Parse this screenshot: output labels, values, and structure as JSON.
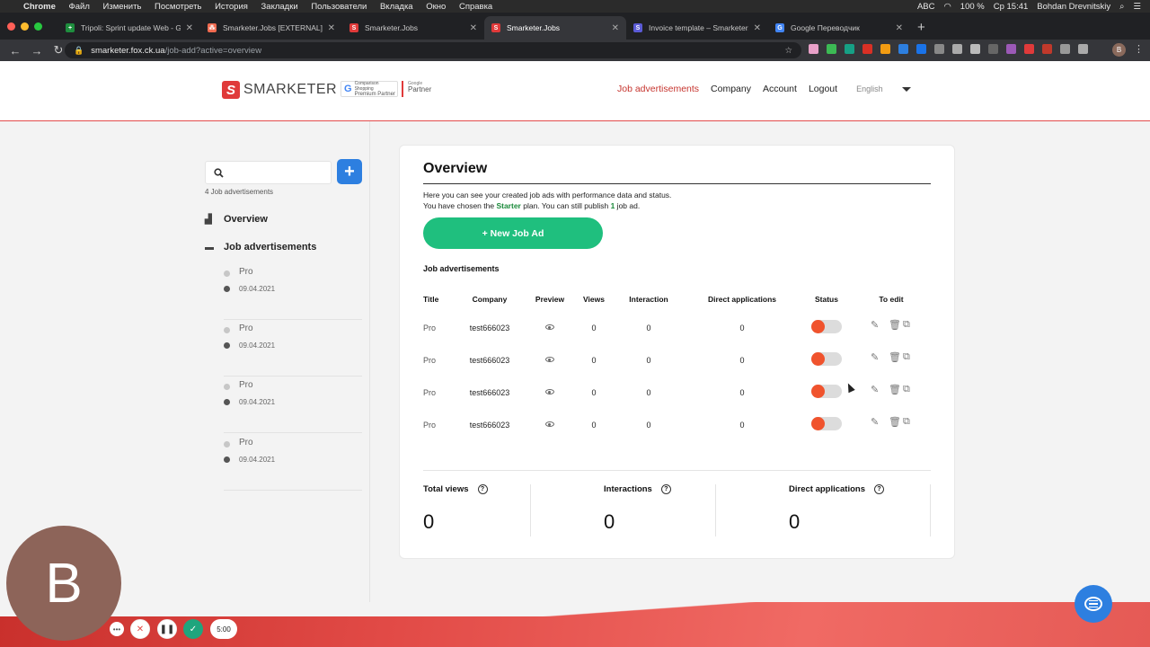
{
  "macos": {
    "app": "Chrome",
    "menus": [
      "Файл",
      "Изменить",
      "Посмотреть",
      "История",
      "Закладки",
      "Пользователи",
      "Вкладка",
      "Окно",
      "Справка"
    ],
    "battery": "100 %",
    "clock": "Ср 15:41",
    "user": "Bohdan Drevnitskiy",
    "input": "ABC"
  },
  "browser": {
    "tabs": [
      {
        "title": "Tripoli: Sprint update Web - Go",
        "color": "#1e8e3e",
        "glyph": "+"
      },
      {
        "title": "Smarketer.Jobs [EXTERNAL]",
        "color": "#f06a4f",
        "glyph": "⁂"
      },
      {
        "title": "Smarketer.Jobs",
        "color": "#e03a3a",
        "glyph": "S"
      },
      {
        "title": "Smarketer.Jobs",
        "color": "#e03a3a",
        "glyph": "S"
      },
      {
        "title": "Invoice template – Smarketer.J",
        "color": "#5b5bd6",
        "glyph": "S"
      },
      {
        "title": "Google Переводчик",
        "color": "#4285f4",
        "glyph": "G"
      }
    ],
    "url_host": "smarketer.fox.ck.ua",
    "url_path": "/job-add?active=overview",
    "profile_initial": "B"
  },
  "header": {
    "logo_text": "SMARKETER",
    "badge1_small": "Comparison Shopping",
    "badge1_text": "Premium Partner",
    "badge2_small": "Google",
    "badge2_text": "Partner",
    "nav": [
      "Job advertisements",
      "Company",
      "Account",
      "Logout"
    ],
    "lang": "English"
  },
  "sidebar": {
    "count": "4 Job advertisements",
    "overview": "Overview",
    "jobs_label": "Job advertisements",
    "items": [
      {
        "name": "Pro",
        "date": "09.04.2021"
      },
      {
        "name": "Pro",
        "date": "09.04.2021"
      },
      {
        "name": "Pro",
        "date": "09.04.2021"
      },
      {
        "name": "Pro",
        "date": "09.04.2021"
      }
    ]
  },
  "overview": {
    "title": "Overview",
    "desc1": "Here you can see your created job ads with performance data and status.",
    "desc2_pre": "You have chosen the ",
    "plan": "Starter",
    "desc2_mid": " plan. You can still publish ",
    "remaining": "1",
    "desc2_post": " job ad.",
    "new_button": "+ New Job Ad",
    "section": "Job advertisements",
    "columns": [
      "Title",
      "Company",
      "Preview",
      "Views",
      "Interaction",
      "Direct applications",
      "Status",
      "To edit"
    ],
    "rows": [
      {
        "title": "Pro",
        "company": "test666023",
        "views": "0",
        "interaction": "0",
        "direct": "0",
        "status": "off"
      },
      {
        "title": "Pro",
        "company": "test666023",
        "views": "0",
        "interaction": "0",
        "direct": "0",
        "status": "off"
      },
      {
        "title": "Pro",
        "company": "test666023",
        "views": "0",
        "interaction": "0",
        "direct": "0",
        "status": "off"
      },
      {
        "title": "Pro",
        "company": "test666023",
        "views": "0",
        "interaction": "0",
        "direct": "0",
        "status": "off"
      }
    ],
    "stats": [
      {
        "label": "Total views",
        "value": "0"
      },
      {
        "label": "Interactions",
        "value": "0"
      },
      {
        "label": "Direct applications",
        "value": "0"
      }
    ]
  },
  "recorder": {
    "avatar_initial": "B",
    "timer": "5:00"
  }
}
